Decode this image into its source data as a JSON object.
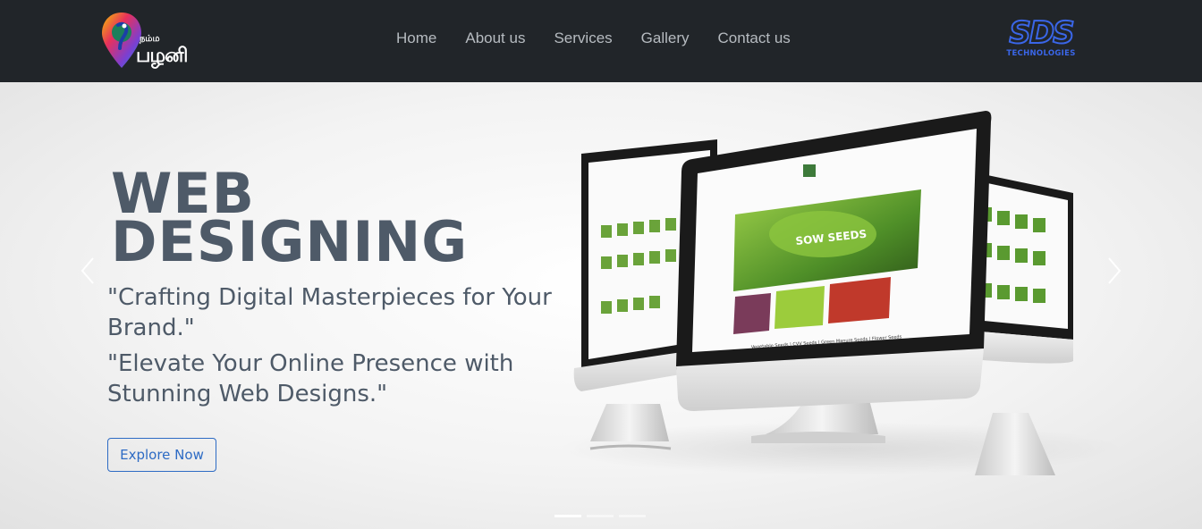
{
  "navbar": {
    "logo_left": {
      "top_text": "நம்ம",
      "main_text": "பழனி",
      "icon": "peacock-pin-logo"
    },
    "links": [
      "Home",
      "About us",
      "Services",
      "Gallery",
      "Contact us"
    ],
    "logo_right": {
      "main_text": "SDS",
      "sub_text": "TECHNOLOGIES"
    }
  },
  "hero": {
    "heading_line1": "WEB",
    "heading_line2": "DESIGNING",
    "tagline1": "\"Crafting Digital Masterpieces for Your Brand.\"",
    "tagline2": "\"Elevate Your Online Presence with Stunning Web Designs.\"",
    "cta_label": "Explore Now",
    "prev_icon": "chevron-left-icon",
    "next_icon": "chevron-right-icon",
    "indicators_count": 3,
    "active_indicator": 1
  },
  "screen": {
    "brand": "SOW SEEDS",
    "caption": "Vegetable Seeds | CVV Seeds | Green Manure Seeds | Flower Seeds"
  },
  "colors": {
    "navbar_bg": "#212529",
    "nav_text": "#b6bbc0",
    "heading": "#4e5a68",
    "accent_blue": "#2d6bc4"
  }
}
